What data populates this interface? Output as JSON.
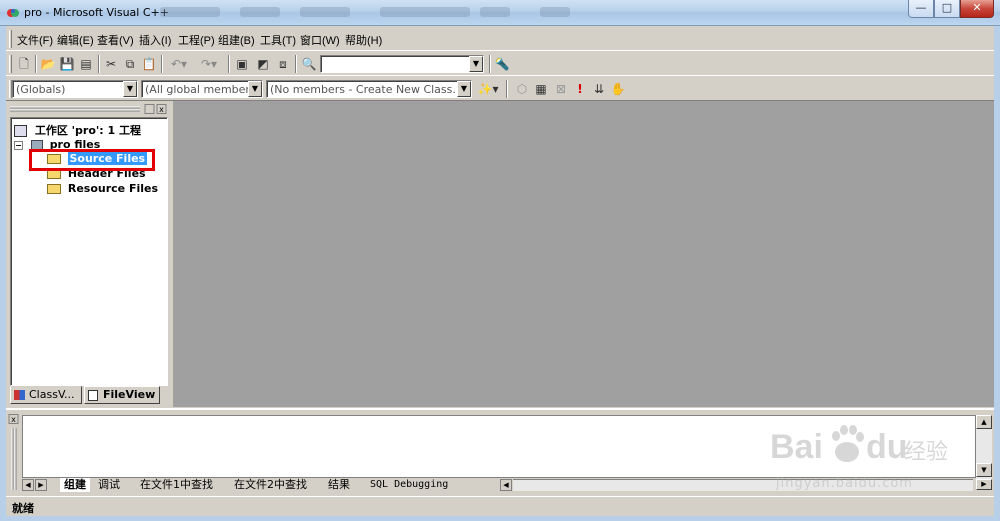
{
  "window": {
    "title": "pro - Microsoft Visual C++",
    "minimize": "—",
    "maximize": "□",
    "close": "✕"
  },
  "menu": [
    "文件(F)",
    "编辑(E)",
    "查看(V)",
    "插入(I)",
    "工程(P)",
    "组建(B)",
    "工具(T)",
    "窗口(W)",
    "帮助(H)"
  ],
  "toolbar": {
    "find_value": "",
    "globals": "(Globals)",
    "members": "(All global members",
    "class_wizard": "(No members - Create New Class..."
  },
  "workspace": {
    "root": "工作区 'pro': 1 工程",
    "project": "pro files",
    "folders": [
      "Source Files",
      "Header Files",
      "Resource Files"
    ],
    "tabs": [
      "ClassV...",
      "FileView"
    ]
  },
  "output": {
    "tabs": [
      "组建",
      "调试",
      "在文件1中查找",
      "在文件2中查找",
      "结果",
      "SQL Debugging"
    ]
  },
  "status": "就绪",
  "watermark": {
    "brand": "Bai",
    "brand2": "du",
    "cn": "经验",
    "url": "jingyan.baidu.com"
  },
  "colors": {
    "highlight": "#3399ff",
    "annotation": "#e00000",
    "editor_bg": "#a0a0a0"
  }
}
